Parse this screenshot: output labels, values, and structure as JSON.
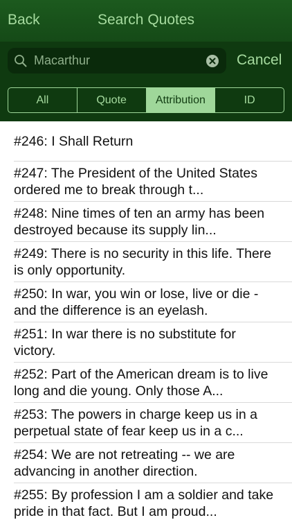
{
  "navbar": {
    "back_label": "Back",
    "title": "Search Quotes"
  },
  "search": {
    "value": "Macarthur",
    "cancel_label": "Cancel",
    "icons": {
      "search": "search-icon",
      "clear": "clear-icon"
    }
  },
  "scope": {
    "segments": [
      "All",
      "Quote",
      "Attribution",
      "ID"
    ],
    "selected": "Attribution"
  },
  "results": [
    "#246: I Shall Return",
    "#247: The President of the United States ordered me to break through t...",
    "#248: Nine times of ten an army has been destroyed because its supply lin...",
    "#249: There is no security in this life. There is only opportunity.",
    "#250: In war, you win or lose, live or die - and the difference is an eyelash.",
    "#251: In war there is no substitute for victory.",
    "#252: Part of the American dream is to live long and die young. Only those A...",
    "#253: The powers in charge keep us in a perpetual state of fear keep us in a c...",
    "#254: We are not retreating -- we are advancing in another direction.",
    "#255: By profession I am a soldier and take pride in that fact. But I am proud..."
  ],
  "colors": {
    "accent": "#9fd79a",
    "navbar": "#1c5a1e",
    "searchbar": "#0f3a10"
  }
}
